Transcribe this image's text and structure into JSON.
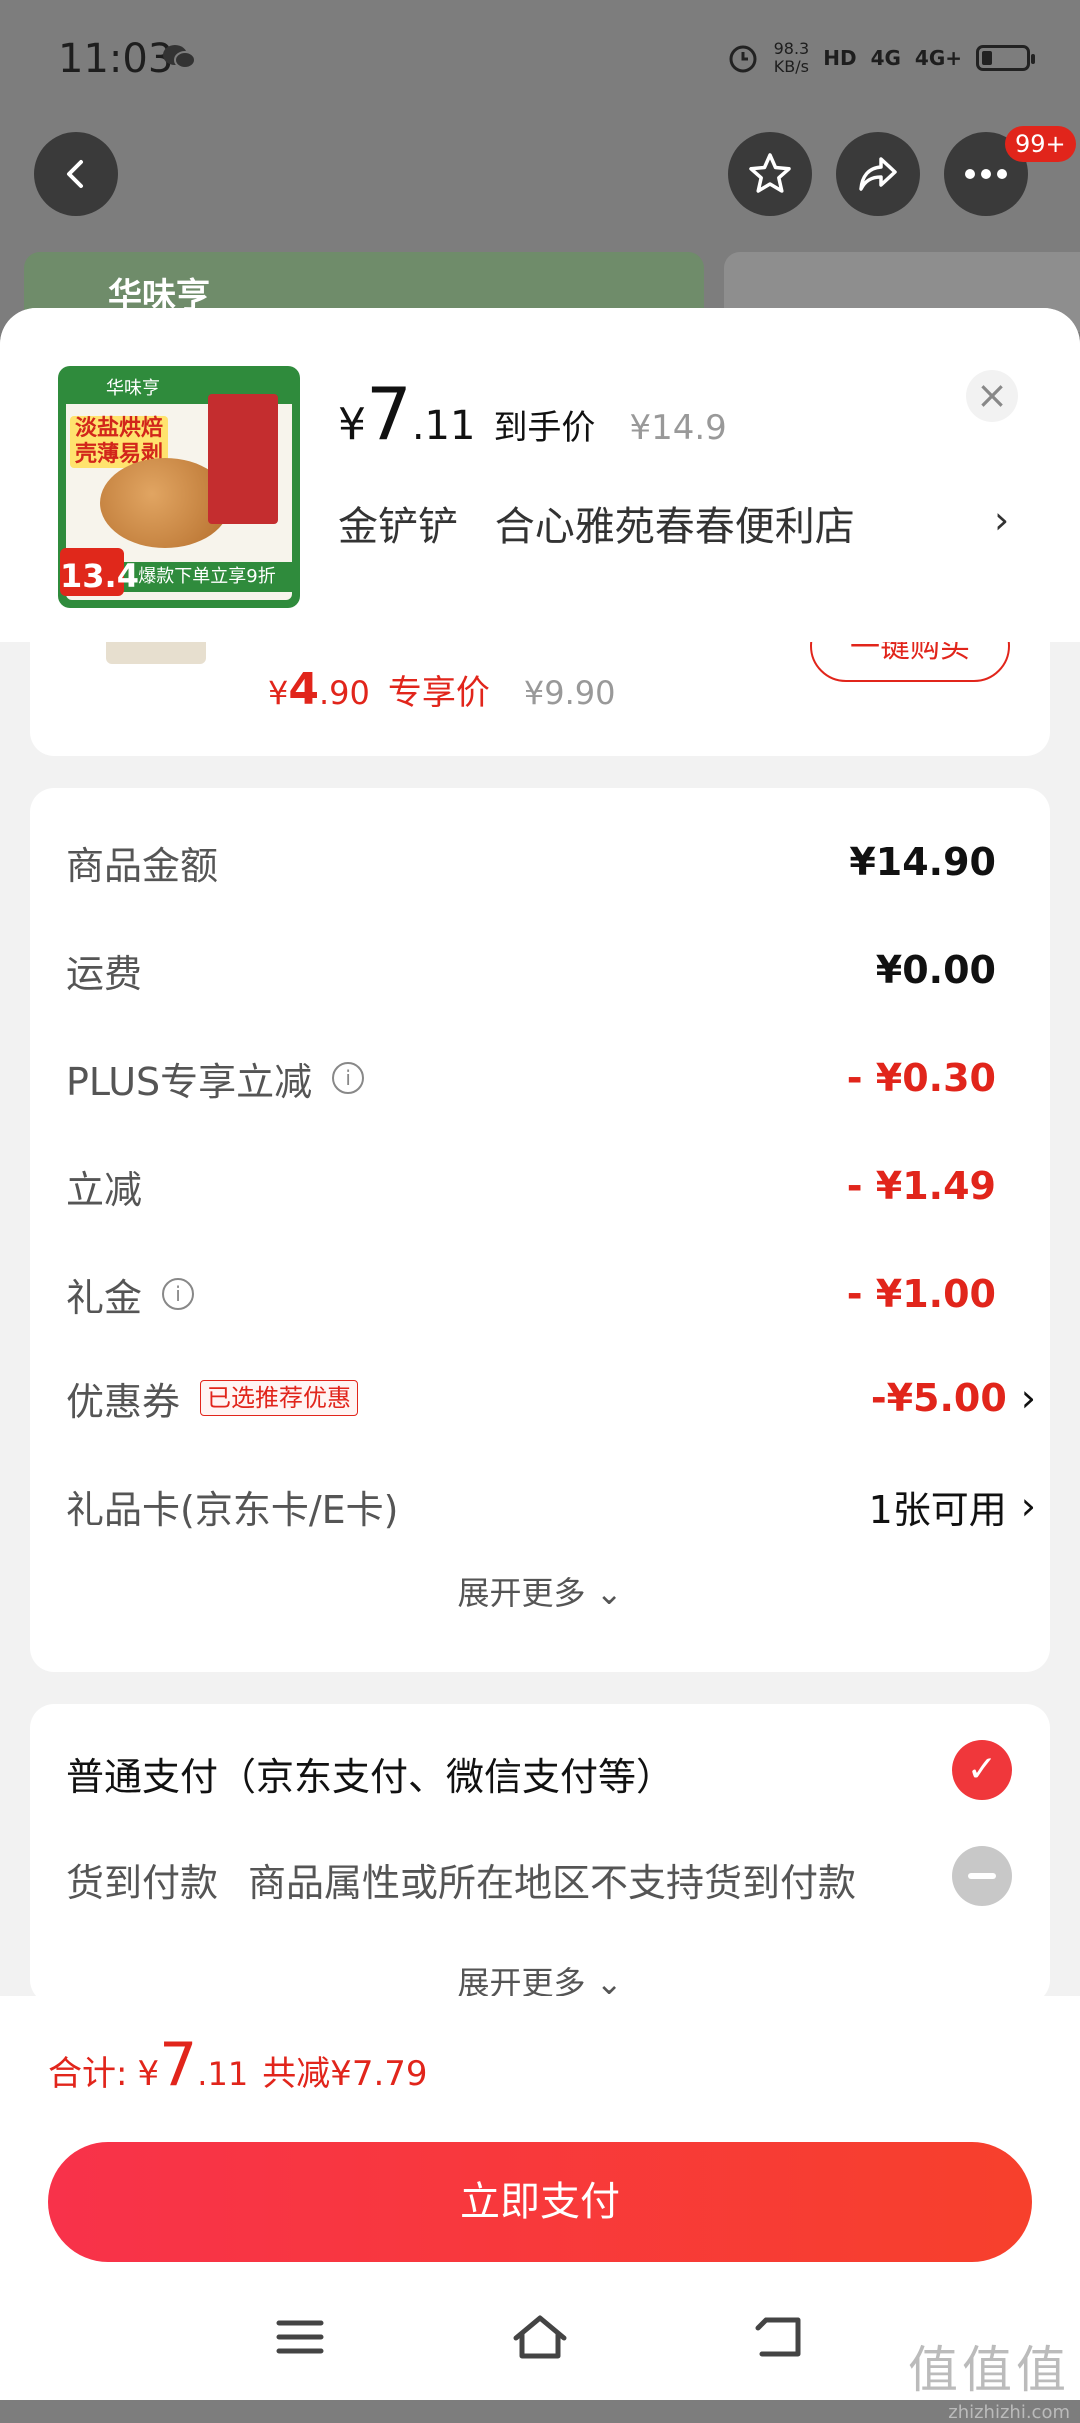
{
  "status_bar": {
    "time": "11:03",
    "net_speed_value": "98.3",
    "net_speed_unit": "KB/s",
    "hd_label": "HD",
    "net_4g": "4G",
    "net_4g_plus": "4G+"
  },
  "top_actions": {
    "badge": "99+"
  },
  "background": {
    "brand": "华味亨"
  },
  "product_header": {
    "price_symbol": "¥",
    "price_int": "7",
    "price_dec": ".11",
    "price_tag": "到手价",
    "original_price": "¥14.9",
    "shop_prefix": "金铲铲",
    "shop_name": "合心雅苑春春便利店",
    "thumb": {
      "brand": "华味亨",
      "label": "淡盐烘焙 壳薄易剥",
      "price": "13.4",
      "promo": "爆款下单立享9折"
    }
  },
  "recommend": {
    "price_symbol": "¥",
    "price_int": "4",
    "price_dec": ".90",
    "tag": "专享价",
    "original_price": "¥9.90",
    "buy_label": "一键购买"
  },
  "fees": [
    {
      "label": "商品金额",
      "value": "¥14.90"
    },
    {
      "label": "运费",
      "value": "¥0.00"
    },
    {
      "label": "PLUS专享立减",
      "value": "- ¥0.30"
    },
    {
      "label": "立减",
      "value": "- ¥1.49"
    },
    {
      "label": "礼金",
      "value": "- ¥1.00"
    },
    {
      "label": "优惠券",
      "chip": "已选推荐优惠",
      "value": "-¥5.00"
    },
    {
      "label": "礼品卡(京东卡/E卡)",
      "value": "1张可用"
    }
  ],
  "expand_more": "展开更多",
  "payment": {
    "option1": "普通支付（京东支付、微信支付等）",
    "option2_label": "货到付款",
    "option2_desc": "商品属性或所在地区不支持货到付款",
    "expand_more": "展开更多"
  },
  "total": {
    "label": "合计:",
    "symbol": "¥",
    "int": "7",
    "dec": ".11",
    "saved": "共减¥7.79"
  },
  "pay_button": "立即支付",
  "watermark": {
    "main": "值值值",
    "sub": "zhizhizhi.com"
  }
}
